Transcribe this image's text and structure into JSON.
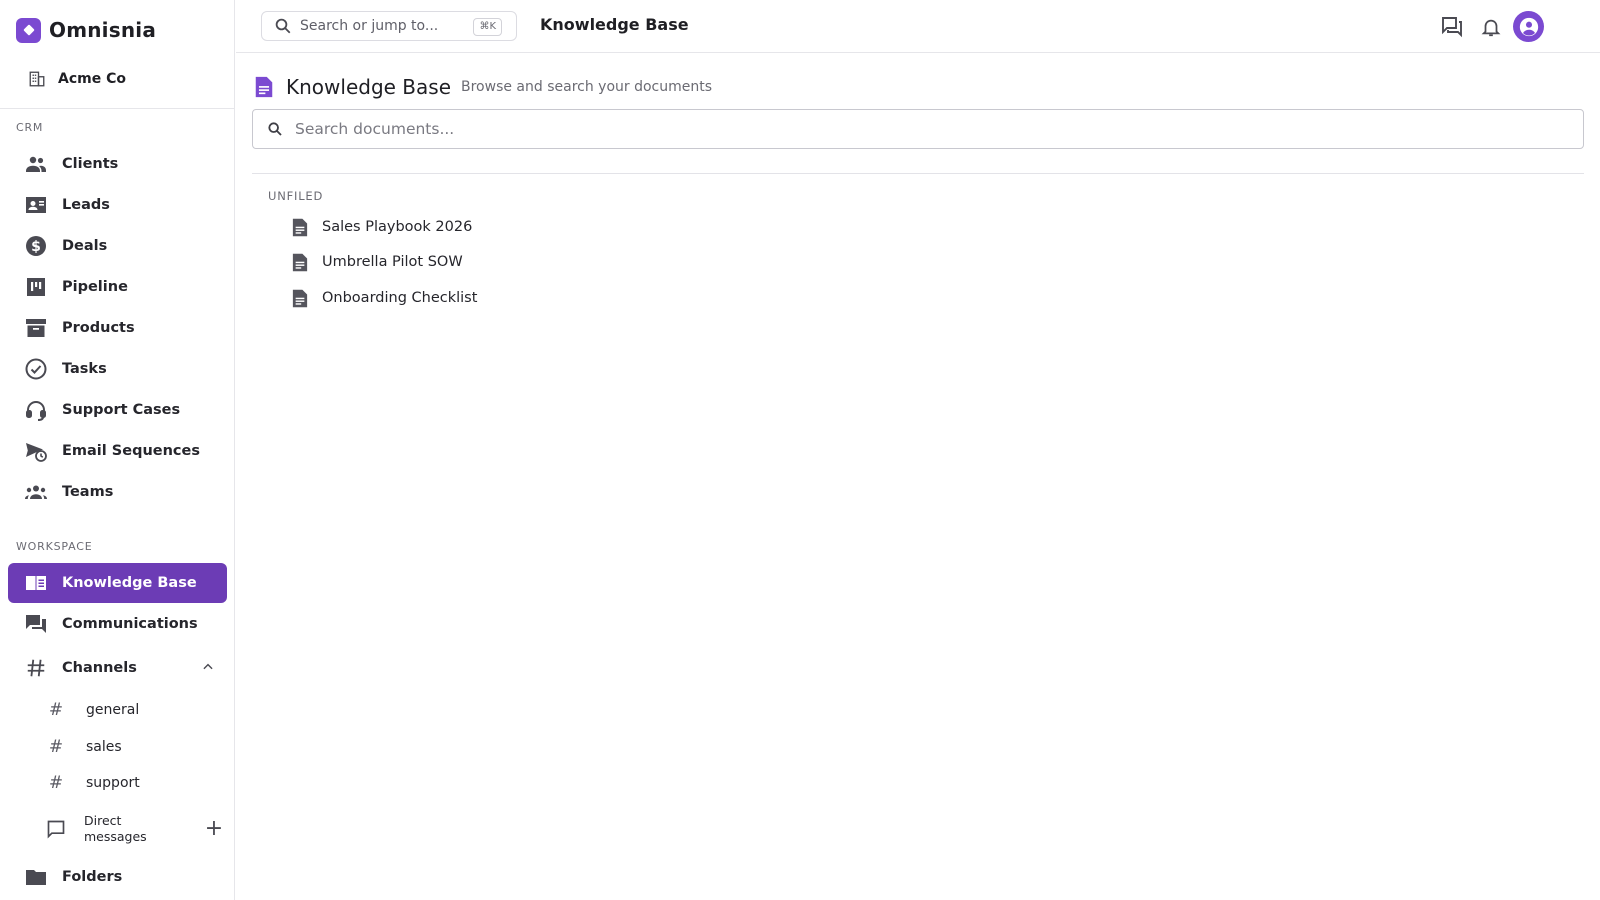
{
  "brand": {
    "name": "Omnisnia",
    "logo_icon": "diamond-icon",
    "accent": "#7b4ad1"
  },
  "org": {
    "name": "Acme Co",
    "icon": "building-icon"
  },
  "sidebar": {
    "crm_label": "CRM",
    "crm_items": [
      {
        "label": "Clients",
        "icon": "people-icon"
      },
      {
        "label": "Leads",
        "icon": "contact-card-icon"
      },
      {
        "label": "Deals",
        "icon": "dollar-icon"
      },
      {
        "label": "Pipeline",
        "icon": "kanban-icon"
      },
      {
        "label": "Products",
        "icon": "archive-box-icon"
      },
      {
        "label": "Tasks",
        "icon": "check-circle-icon"
      },
      {
        "label": "Support Cases",
        "icon": "headset-icon"
      },
      {
        "label": "Email Sequences",
        "icon": "scheduled-send-icon"
      },
      {
        "label": "Teams",
        "icon": "groups-icon"
      }
    ],
    "workspace_label": "WORKSPACE",
    "workspace_items": [
      {
        "label": "Knowledge Base",
        "icon": "book-icon",
        "active": true
      },
      {
        "label": "Communications",
        "icon": "forum-icon",
        "active": false
      }
    ],
    "channels": {
      "label": "Channels",
      "items": [
        {
          "label": "general"
        },
        {
          "label": "sales"
        },
        {
          "label": "support"
        }
      ]
    },
    "direct_messages": {
      "label": "Direct messages"
    },
    "folders": {
      "label": "Folders"
    },
    "active_color": "#6c3cb5"
  },
  "topbar": {
    "search_placeholder": "Search or jump to...",
    "shortcut": "⌘K",
    "title": "Knowledge Base"
  },
  "main": {
    "title": "Knowledge Base",
    "subtitle": "Browse and search your documents",
    "search_placeholder": "Search documents...",
    "group_label": "UNFILED",
    "documents": [
      {
        "title": "Sales Playbook 2026"
      },
      {
        "title": "Umbrella Pilot SOW"
      },
      {
        "title": "Onboarding Checklist"
      }
    ]
  }
}
